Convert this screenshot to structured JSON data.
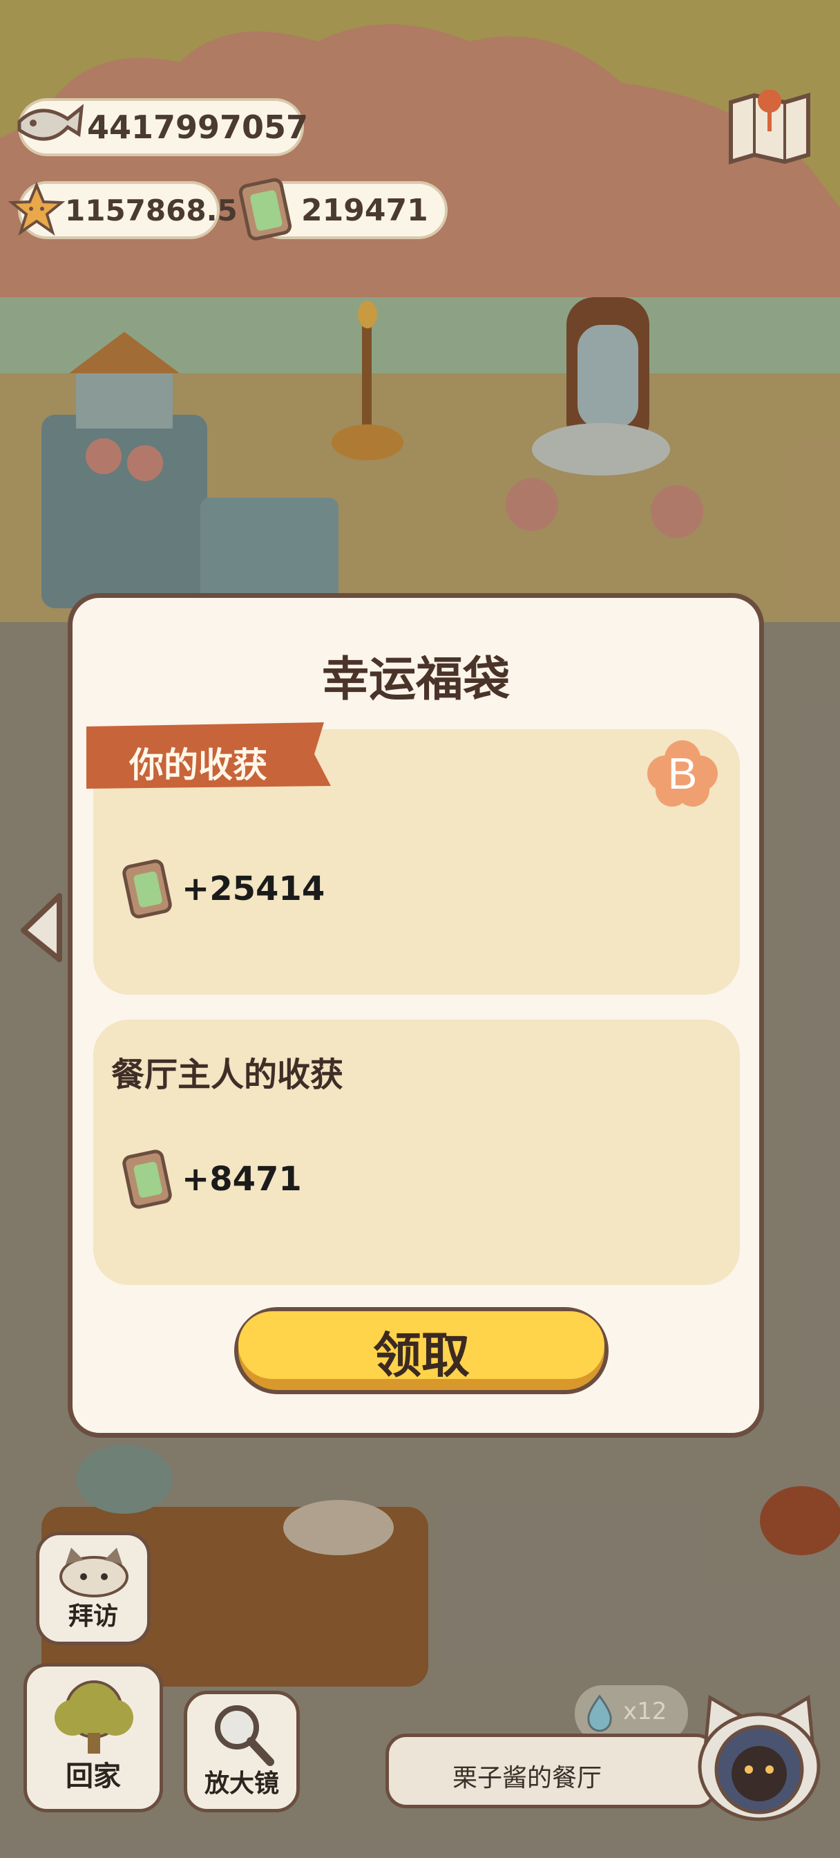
{
  "resources": {
    "fish": "4417997057",
    "stars": "1157868.5",
    "tickets": "219471"
  },
  "modal": {
    "title": "幸运福袋",
    "your_harvest": {
      "label": "你的收获",
      "badge": "B",
      "reward": "+25414"
    },
    "owner_harvest": {
      "label": "餐厅主人的收获",
      "reward": "+8471"
    },
    "claim_label": "领取"
  },
  "bottom_nav": {
    "visit": "拜访",
    "home": "回家",
    "magnifier": "放大镜"
  },
  "restaurant": {
    "name": "栗子酱的餐厅",
    "drops": "x12"
  },
  "icons": [
    "fish-icon",
    "star-icon",
    "ticket-icon",
    "map-icon",
    "left-arrow-icon",
    "badge-b-icon",
    "water-drop-icon",
    "cat-avatar-icon",
    "magnifier-icon",
    "tree-icon",
    "cat-visit-icon"
  ],
  "colors": {
    "accent_orange": "#c8643a",
    "button_yellow": "#ffd34a",
    "card_bg": "#f4e5c3",
    "modal_bg": "#fbf5eb",
    "border_brown": "#6b4e3f"
  }
}
